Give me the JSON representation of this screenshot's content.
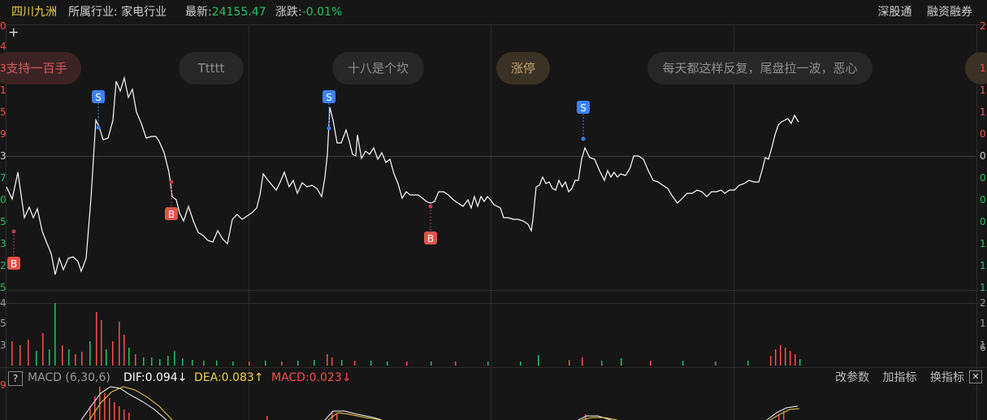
{
  "header": {
    "stock_name": "四川九洲",
    "industry_text": "所属行业: 家电行业",
    "latest_label": "最新:",
    "latest_value": "24155.47",
    "change_label": "涨跌:",
    "change_value": "-0.01%",
    "right_links": [
      "深股通",
      "融资融券"
    ]
  },
  "bullets": [
    "支持一百手",
    "Ttttt",
    "十八是个坎",
    "涨停",
    "每天都这样反复，尾盘拉一波，恶心"
  ],
  "signals": {
    "s": "S",
    "b": "B"
  },
  "macd": {
    "help": "?",
    "name": "MACD (6,30,6)",
    "dif": "DIF:0.094↓",
    "dea": "DEA:0.083↑",
    "value": "MACD:0.023↓",
    "tools": [
      "改参数",
      "加指标",
      "换指标"
    ],
    "close": "✕"
  },
  "left_axis": [
    "0",
    "4",
    "3",
    "1",
    "5",
    "9",
    "3",
    "7",
    "0",
    "5",
    "3",
    "2",
    "5",
    "4",
    "5",
    "3",
    "9"
  ],
  "right_axis": [
    "2",
    "1",
    "1",
    "1",
    "0",
    "0",
    "0",
    "0",
    "0",
    "1",
    "1",
    "1",
    "2",
    "1",
    "1",
    "6"
  ],
  "colors": {
    "up": "#ff4d4d",
    "down": "#22c55e",
    "price_line": "#ffffff",
    "dea_line": "#f2d24b",
    "buy_marker": "#e0514a",
    "sell_marker": "#3b82f6"
  }
}
